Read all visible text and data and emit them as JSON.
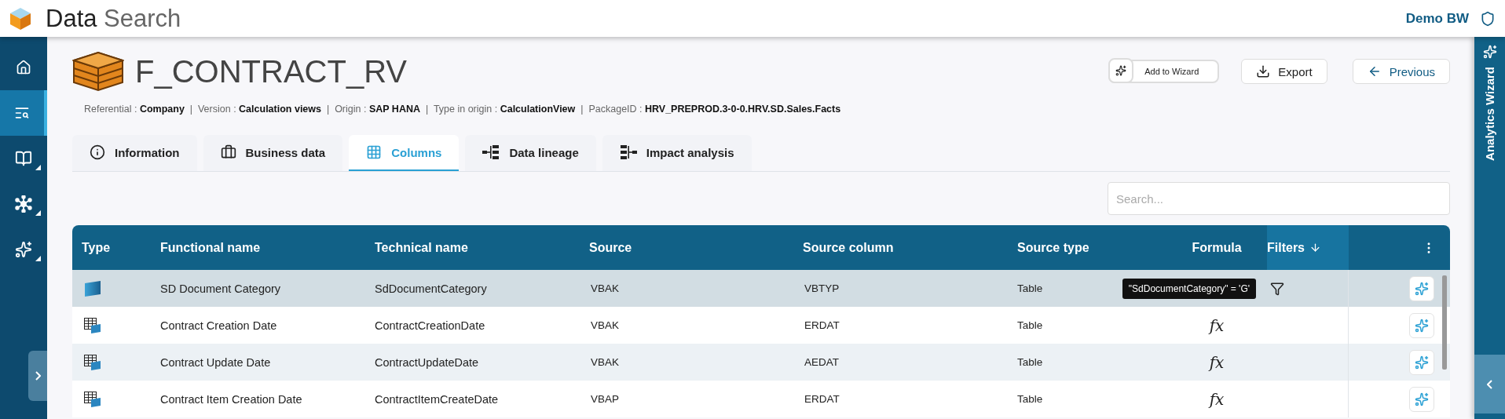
{
  "app": {
    "title_bold": "Data",
    "title_light": "Search",
    "user": "Demo BW"
  },
  "sidebar": {
    "items": [
      {
        "selected": false,
        "submenu": false
      },
      {
        "selected": true,
        "submenu": false
      },
      {
        "selected": false,
        "submenu": true
      },
      {
        "selected": false,
        "submenu": true
      },
      {
        "selected": false,
        "submenu": true
      }
    ]
  },
  "right_panel": {
    "title": "Analytics Wizard"
  },
  "object": {
    "title": "F_CONTRACT_RV",
    "separator": "|",
    "meta": [
      {
        "label": "Referential :",
        "value": "Company"
      },
      {
        "label": "Version :",
        "value": "Calculation views"
      },
      {
        "label": "Origin :",
        "value": "SAP HANA"
      },
      {
        "label": "Type in origin :",
        "value": "CalculationView"
      },
      {
        "label": "PackageID :",
        "value": "HRV_PREPROD.3-0-0.HRV.SD.Sales.Facts"
      }
    ]
  },
  "actions": {
    "wizard": "Add to Wizard",
    "export": "Export",
    "previous": "Previous"
  },
  "tabs": [
    {
      "label": "Information",
      "selected": false
    },
    {
      "label": "Business data",
      "selected": false
    },
    {
      "label": "Columns",
      "selected": true
    },
    {
      "label": "Data lineage",
      "selected": false
    },
    {
      "label": "Impact analysis",
      "selected": false
    }
  ],
  "search": {
    "placeholder": "Search..."
  },
  "table": {
    "columns": [
      "Type",
      "Functional name",
      "Technical name",
      "Source",
      "Source column",
      "Source type",
      "Formula",
      "Filters"
    ],
    "rows": [
      {
        "kind": "field",
        "functional_name": "SD Document Category",
        "technical_name": "SdDocumentCategory",
        "source": "VBAK",
        "source_column": "VBTYP",
        "source_type": "Table",
        "filtered": true,
        "tooltip": "\"SdDocumentCategory\" = 'G'",
        "selected": true
      },
      {
        "kind": "table",
        "functional_name": "Contract Creation Date",
        "technical_name": "ContractCreationDate",
        "source": "VBAK",
        "source_column": "ERDAT",
        "source_type": "Table",
        "formula": "fx",
        "filtered": false,
        "selected": false
      },
      {
        "kind": "table",
        "functional_name": "Contract Update Date",
        "technical_name": "ContractUpdateDate",
        "source": "VBAK",
        "source_column": "AEDAT",
        "source_type": "Table",
        "formula": "fx",
        "filtered": false,
        "selected": false
      },
      {
        "kind": "table",
        "functional_name": "Contract Item Creation Date",
        "technical_name": "ContractItemCreateDate",
        "source": "VBAP",
        "source_column": "ERDAT",
        "source_type": "Table",
        "formula": "fx",
        "filtered": false,
        "selected": false
      }
    ]
  }
}
